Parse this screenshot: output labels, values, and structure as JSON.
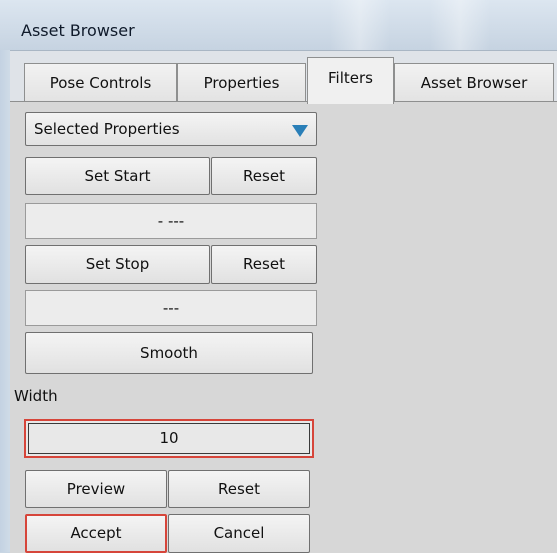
{
  "window": {
    "title": "Asset Browser"
  },
  "tabs": [
    {
      "label": "Pose Controls"
    },
    {
      "label": "Properties"
    },
    {
      "label": "Filters",
      "active": true
    },
    {
      "label": "Asset Browser"
    }
  ],
  "filters": {
    "selector": {
      "value": "Selected Properties",
      "arrow_color": "#2a7fb8"
    },
    "set_start_label": "Set Start",
    "start_reset_label": "Reset",
    "start_value": "- ---",
    "set_stop_label": "Set Stop",
    "stop_reset_label": "Reset",
    "stop_value": "---",
    "smooth_label": "Smooth",
    "width_label": "Width",
    "width_value": "10",
    "preview_label": "Preview",
    "preview_reset_label": "Reset",
    "accept_label": "Accept",
    "cancel_label": "Cancel"
  },
  "colors": {
    "highlight_border": "#d6453a"
  }
}
